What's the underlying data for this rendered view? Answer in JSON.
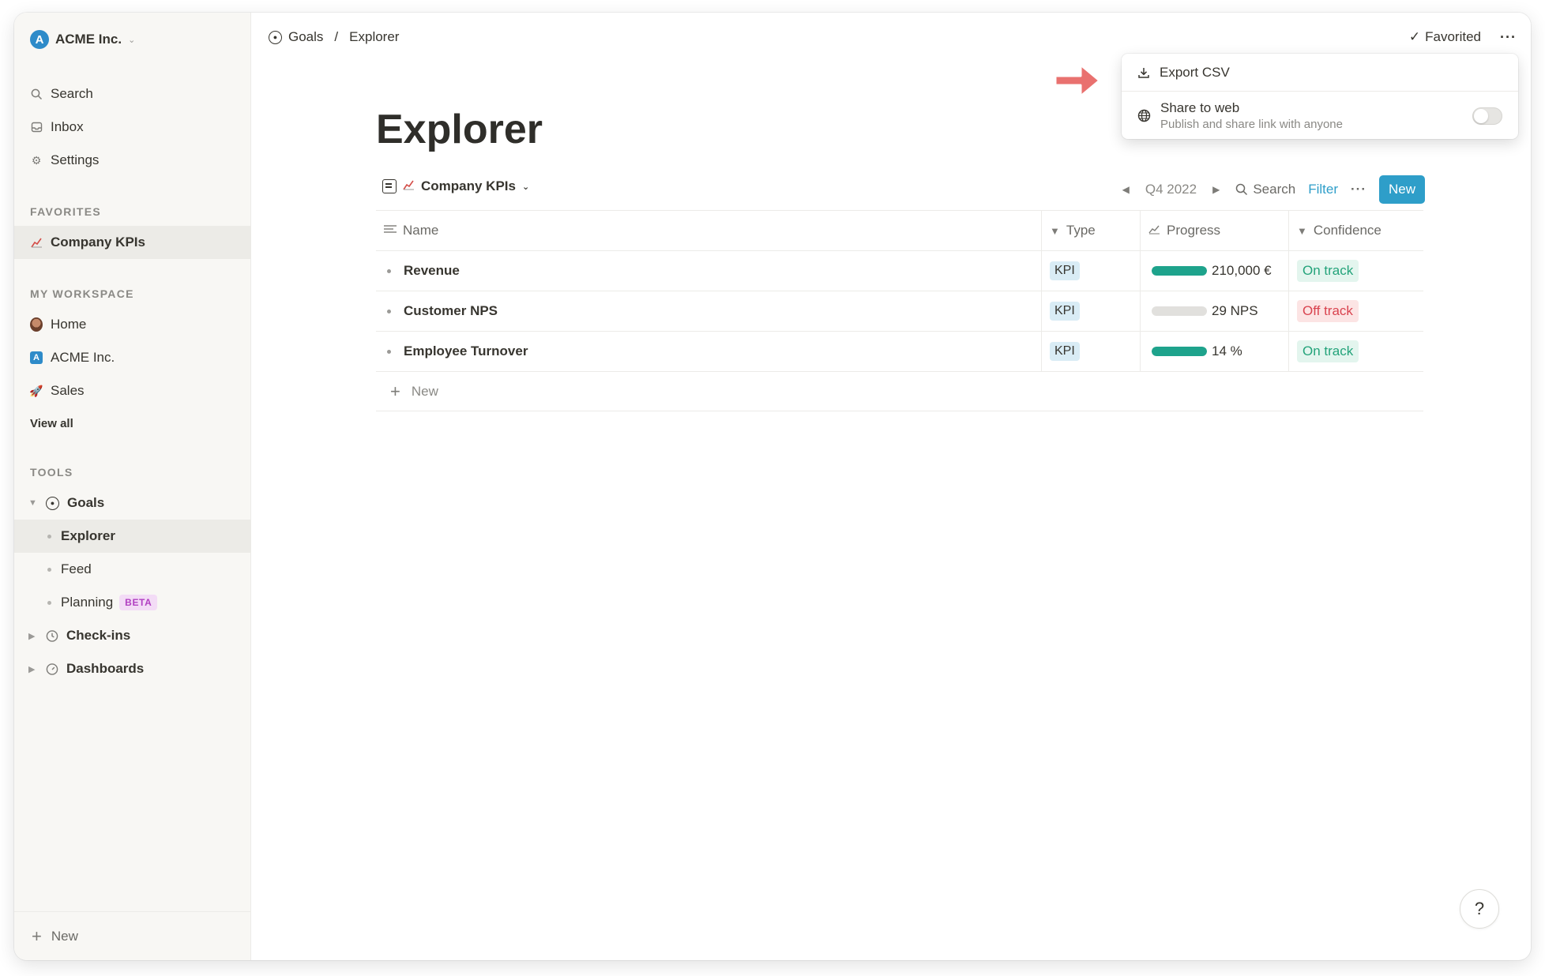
{
  "workspace": {
    "name": "ACME Inc.",
    "logo_letter": "A"
  },
  "sidebar": {
    "nav": [
      {
        "label": "Search",
        "icon": "search-icon"
      },
      {
        "label": "Inbox",
        "icon": "inbox-icon"
      },
      {
        "label": "Settings",
        "icon": "gear-icon"
      }
    ],
    "favorites_label": "FAVORITES",
    "favorites": [
      {
        "label": "Company KPIs",
        "icon": "chart-icon"
      }
    ],
    "workspace_label": "MY WORKSPACE",
    "workspace_items": [
      {
        "label": "Home",
        "icon": "avatar"
      },
      {
        "label": "ACME Inc.",
        "icon": "acme-logo-icon"
      },
      {
        "label": "Sales",
        "icon": "rocket-icon"
      }
    ],
    "view_all": "View all",
    "tools_label": "TOOLS",
    "tools": {
      "goals": "Goals",
      "goals_children": [
        "Explorer",
        "Feed",
        "Planning"
      ],
      "beta": "BETA",
      "checkins": "Check-ins",
      "dashboards": "Dashboards"
    },
    "footer_new": "New"
  },
  "breadcrumb": {
    "parent": "Goals",
    "sep": "/",
    "current": "Explorer"
  },
  "header": {
    "favorited": "Favorited"
  },
  "page": {
    "title": "Explorer"
  },
  "toolbar": {
    "view_name": "Company KPIs",
    "period": "Q4 2022",
    "search": "Search",
    "filter": "Filter",
    "new": "New"
  },
  "table": {
    "columns": [
      "Name",
      "Type",
      "Progress",
      "Confidence"
    ],
    "rows": [
      {
        "name": "Revenue",
        "type": "KPI",
        "progress": 1.0,
        "value": "210,000 €",
        "confidence": "On track",
        "status": "on"
      },
      {
        "name": "Customer NPS",
        "type": "KPI",
        "progress": 0.0,
        "value": "29 NPS",
        "confidence": "Off track",
        "status": "off"
      },
      {
        "name": "Employee Turnover",
        "type": "KPI",
        "progress": 1.0,
        "value": "14 %",
        "confidence": "On track",
        "status": "on"
      }
    ],
    "new_row": "New"
  },
  "menu": {
    "export": "Export CSV",
    "share_title": "Share to web",
    "share_sub": "Publish and share link with anyone",
    "share_enabled": false
  },
  "help": "?",
  "colors": {
    "accent": "#2e9ec9",
    "progress": "#1ea38c",
    "on_track": "#23a37a",
    "off_track": "#d9434f",
    "annotation_arrow": "#e9716f"
  }
}
